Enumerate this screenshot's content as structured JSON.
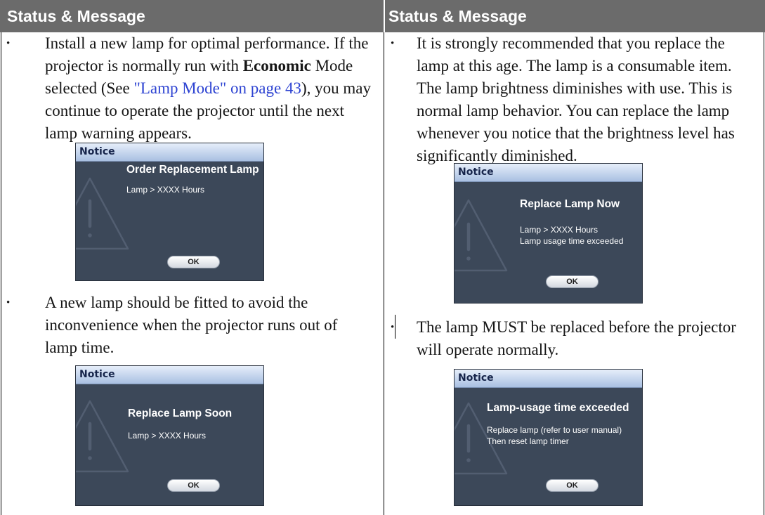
{
  "theme": {
    "header-bg": "#6b6b6b",
    "header-text": "#ffffff",
    "link": "#2d43d2",
    "dialog-body": "#3c4859",
    "dialog-bar-top": "#e6eefa",
    "dialog-bar-bottom": "#a9c0e2",
    "dialog-title": "#16244a"
  },
  "table": {
    "header_left": "Status & Message",
    "header_right": "Status & Message"
  },
  "left_column": {
    "item_1": {
      "bullet": "•",
      "lines": [
        "Install a new lamp for optimal performance. If the",
        {
          "pre": "projector is normally run with ",
          "bold": "Economic",
          "post": " Mode"
        },
        {
          "pre": "selected (See ",
          "link": "\"Lamp Mode\" on page 43",
          "post": "), you may"
        },
        "continue to operate the projector until the next",
        "lamp warning appears."
      ],
      "dialog": {
        "title": "Notice",
        "icon": "warning-triangle-icon",
        "heading": "Order Replacement Lamp",
        "messages": [
          "Lamp > XXXX Hours"
        ],
        "button": "OK"
      }
    },
    "item_2": {
      "bullet": "•",
      "lines": [
        "A new lamp should be fitted to avoid the",
        "inconvenience when the projector runs out of",
        "lamp time."
      ],
      "dialog": {
        "title": "Notice",
        "icon": "warning-triangle-icon",
        "heading": "Replace Lamp Soon",
        "messages": [
          "Lamp > XXXX Hours"
        ],
        "button": "OK"
      }
    }
  },
  "right_column": {
    "item_1": {
      "bullet": "•",
      "lines": [
        "It is strongly recommended that you replace the",
        "lamp at this age. The lamp is a consumable item.",
        "The lamp brightness diminishes with use. This is",
        "normal lamp behavior. You can replace the lamp",
        "whenever you notice that the brightness level has",
        "significantly diminished."
      ],
      "dialog": {
        "title": "Notice",
        "icon": "warning-triangle-icon",
        "heading": "Replace Lamp Now",
        "messages": [
          "Lamp > XXXX Hours",
          "Lamp usage time exceeded"
        ],
        "button": "OK"
      }
    },
    "item_2": {
      "bullet": "•",
      "lines": [
        "The lamp MUST be replaced before the projector",
        "will operate normally."
      ],
      "dialog": {
        "title": "Notice",
        "icon": "warning-triangle-icon",
        "heading": "Lamp-usage time exceeded",
        "messages": [
          "Replace lamp (refer to user manual)",
          "Then reset lamp timer"
        ],
        "button": "OK"
      }
    }
  }
}
